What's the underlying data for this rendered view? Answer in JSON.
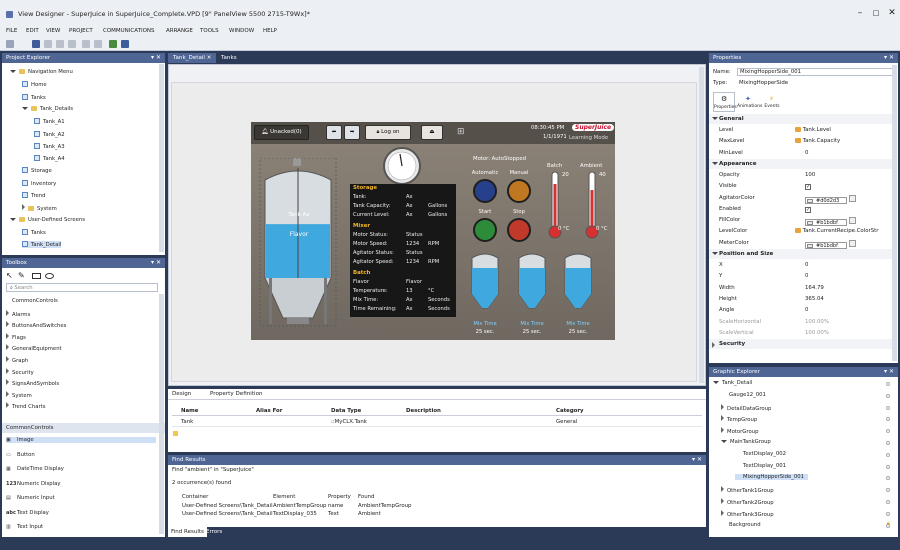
{
  "window": {
    "title": "View Designer - SuperJuice in SuperJuice_Complete.VPD [9\" PanelView 5500 2715-T9Wx]*"
  },
  "menu": [
    "FILE",
    "EDIT",
    "VIEW",
    "PROJECT",
    "COMMUNICATIONS",
    "ARRANGE",
    "TOOLS",
    "WINDOW",
    "HELP"
  ],
  "project_explorer": {
    "title": "Project Explorer",
    "items": [
      {
        "label": "Navigation Menu",
        "kind": "folder",
        "expanded": true
      },
      {
        "label": "Home",
        "kind": "page"
      },
      {
        "label": "Tanks",
        "kind": "page"
      },
      {
        "label": "Tank_Details",
        "kind": "folder",
        "expanded": true
      },
      {
        "label": "Tank_A1",
        "kind": "page"
      },
      {
        "label": "Tank_A2",
        "kind": "page"
      },
      {
        "label": "Tank_A3",
        "kind": "page"
      },
      {
        "label": "Tank_A4",
        "kind": "page"
      },
      {
        "label": "Storage",
        "kind": "page"
      },
      {
        "label": "Inventory",
        "kind": "page"
      },
      {
        "label": "Trend",
        "kind": "page"
      },
      {
        "label": "System",
        "kind": "folder",
        "expanded": false
      },
      {
        "label": "User-Defined Screens",
        "kind": "folder",
        "expanded": true
      },
      {
        "label": "Tanks",
        "kind": "page"
      },
      {
        "label": "Tank_Detail",
        "kind": "page"
      }
    ]
  },
  "toolbox": {
    "title": "Toolbox",
    "search_placeholder": "Search",
    "categories": [
      "CommonControls",
      "Alarms",
      "ButtonsAndSwitches",
      "Flags",
      "GeneralEquipment",
      "Graph",
      "Security",
      "SignsAndSymbols",
      "System",
      "Trend Charts"
    ],
    "section_title": "CommonControls",
    "controls": [
      {
        "label": "Image",
        "icon": "image-icon",
        "abbr": "▣"
      },
      {
        "label": "Button",
        "icon": "button-icon",
        "abbr": "▭"
      },
      {
        "label": "DateTime Display",
        "icon": "datetime-icon",
        "abbr": "▦"
      },
      {
        "label": "Numeric Display",
        "icon": "numeric-display-icon",
        "abbr": "123"
      },
      {
        "label": "Numeric Input",
        "icon": "numeric-input-icon",
        "abbr": "▤"
      },
      {
        "label": "Text Display",
        "icon": "text-display-icon",
        "abbr": "abc"
      },
      {
        "label": "Text Input",
        "icon": "text-input-icon",
        "abbr": "▥"
      }
    ]
  },
  "doc_tabs": [
    {
      "label": "Tank_Detail"
    },
    {
      "label": "Tanks"
    }
  ],
  "hmi": {
    "unacked": "Unacked(0)",
    "logon": "Log on",
    "datetime": "08:30:45 PM",
    "date": "1/1/1971",
    "mode": "Learning Mode",
    "logo": "SuperJuice",
    "tank_label1": "Tank Ax",
    "tank_label2": "Flavor",
    "motor_status": "Motor: AutoStopped",
    "automatic": "Automatic",
    "manual": "Manual",
    "start": "Start",
    "stop": "Stop",
    "batch": "Batch",
    "ambient": "Ambient",
    "batch_top": "20",
    "ambient_top": "40",
    "batch_bottom": "0 °C",
    "ambient_bottom": "0 °C",
    "mix_label": "Mix Time",
    "mix_value": "25 sec.",
    "storage": {
      "heading": "Storage",
      "rows": [
        [
          "Tank:",
          "Ax",
          ""
        ],
        [
          "Tank Capacity:",
          "Ax",
          "Gallons"
        ],
        [
          "Current Level:",
          "Ax",
          "Gallons"
        ]
      ]
    },
    "mixer": {
      "heading": "Mixer",
      "rows": [
        [
          "Motor Status:",
          "Status",
          ""
        ],
        [
          "Motor Speed:",
          "1234",
          "RPM"
        ],
        [
          "Agitator Status:",
          "Status",
          ""
        ],
        [
          "Agitator Speed:",
          "1234",
          "RPM"
        ]
      ]
    },
    "batch_info": {
      "heading": "Batch",
      "rows": [
        [
          "Flavor",
          "Flavor",
          ""
        ],
        [
          "Temperature:",
          "13",
          "°C"
        ],
        [
          "Mix Time:",
          "Ax",
          "Seconds"
        ],
        [
          "Time Remaining:",
          "Ax",
          "Seconds"
        ]
      ]
    },
    "tank_fill_fraction": 0.55
  },
  "bottom_tabs": [
    "Design",
    "Property Definition"
  ],
  "property_grid": {
    "columns": [
      "Name",
      "Alias For",
      "Data Type",
      "Description",
      "Category"
    ],
    "row": [
      "Tank",
      "",
      "::MyCLX.Tank",
      "",
      "General"
    ]
  },
  "find_results": {
    "title": "Find Results",
    "query": "Find \"ambient\" in \"SuperJuice\"",
    "summary": "2 occurrence(s) found",
    "columns": [
      "Container",
      "Element",
      "Property",
      "Found"
    ],
    "rows": [
      [
        "User-Defined Screens\\Tank_Detail",
        "AmbientTempGroup",
        "name",
        "AmbientTempGroup"
      ],
      [
        "User-Defined Screens\\Tank_Detail",
        "TextDisplay_035",
        "Text",
        "Ambient"
      ]
    ],
    "bottom_tabs": [
      "Find Results",
      "Errors"
    ]
  },
  "properties": {
    "title": "Properties",
    "name_label": "Name:",
    "name_value": "MixingHopperSide_001",
    "type_label": "Type:",
    "type_value": "MixingHopperSide",
    "tabs": [
      "Properties",
      "Animations",
      "Events"
    ],
    "general": {
      "heading": "General",
      "rows": [
        [
          "Level",
          "Tank.Level"
        ],
        [
          "MaxLevel",
          "Tank.Capacity"
        ],
        [
          "MinLevel",
          "0"
        ]
      ]
    },
    "appearance": {
      "heading": "Appearance",
      "rows": [
        [
          "Opacity",
          "100"
        ],
        [
          "Visible",
          "✓"
        ],
        [
          "AgitatorColor",
          "#d0d2d3"
        ],
        [
          "Enabled",
          "✓"
        ],
        [
          "FillColor",
          "#b1bdbf"
        ],
        [
          "LevelColor",
          "Tank.CurrentRecipe.ColorStr"
        ],
        [
          "MeterColor",
          "#b1bdbf"
        ]
      ]
    },
    "position": {
      "heading": "Position and Size",
      "rows": [
        [
          "X",
          "0"
        ],
        [
          "Y",
          "0"
        ],
        [
          "Width",
          "164.79"
        ],
        [
          "Height",
          "365.04"
        ],
        [
          "Angle",
          "0"
        ],
        [
          "ScaleHorizontal",
          "100.00%"
        ],
        [
          "ScaleVertical",
          "100.00%"
        ]
      ]
    },
    "security": {
      "heading": "Security"
    }
  },
  "graphic_explorer": {
    "title": "Graphic Explorer",
    "items": [
      {
        "label": "Tank_Detail",
        "expanded": true
      },
      {
        "label": "Gauge12_001"
      },
      {
        "label": "DetailDataGroup",
        "expanded": false
      },
      {
        "label": "TempGroup",
        "expanded": false
      },
      {
        "label": "MotorGroup",
        "expanded": false
      },
      {
        "label": "MainTankGroup",
        "expanded": true
      },
      {
        "label": "TextDisplay_002"
      },
      {
        "label": "TextDisplay_001"
      },
      {
        "label": "MixingHopperSide_001"
      },
      {
        "label": "OtherTank1Group",
        "expanded": false
      },
      {
        "label": "OtherTank2Group",
        "expanded": false
      },
      {
        "label": "OtherTank3Group",
        "expanded": false
      },
      {
        "label": "Background"
      }
    ]
  },
  "colors": {
    "accent": "#4f6594",
    "dark": "#2b3a56",
    "tank_blue": "#3fa9df",
    "selection": "#cfe0f6"
  }
}
